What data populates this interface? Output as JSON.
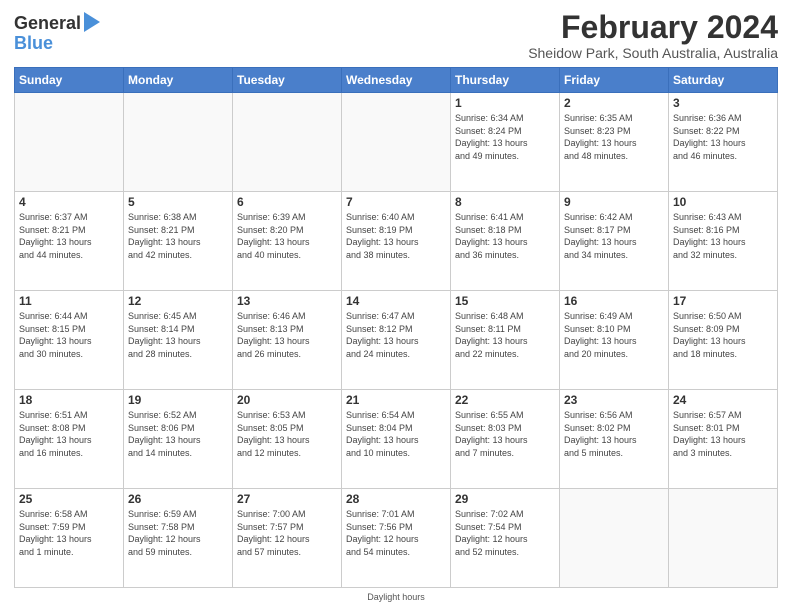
{
  "header": {
    "logo": {
      "general": "General",
      "blue": "Blue"
    },
    "title": "February 2024",
    "subtitle": "Sheidow Park, South Australia, Australia"
  },
  "days_of_week": [
    "Sunday",
    "Monday",
    "Tuesday",
    "Wednesday",
    "Thursday",
    "Friday",
    "Saturday"
  ],
  "weeks": [
    [
      {
        "day": "",
        "info": ""
      },
      {
        "day": "",
        "info": ""
      },
      {
        "day": "",
        "info": ""
      },
      {
        "day": "",
        "info": ""
      },
      {
        "day": "1",
        "info": "Sunrise: 6:34 AM\nSunset: 8:24 PM\nDaylight: 13 hours\nand 49 minutes."
      },
      {
        "day": "2",
        "info": "Sunrise: 6:35 AM\nSunset: 8:23 PM\nDaylight: 13 hours\nand 48 minutes."
      },
      {
        "day": "3",
        "info": "Sunrise: 6:36 AM\nSunset: 8:22 PM\nDaylight: 13 hours\nand 46 minutes."
      }
    ],
    [
      {
        "day": "4",
        "info": "Sunrise: 6:37 AM\nSunset: 8:21 PM\nDaylight: 13 hours\nand 44 minutes."
      },
      {
        "day": "5",
        "info": "Sunrise: 6:38 AM\nSunset: 8:21 PM\nDaylight: 13 hours\nand 42 minutes."
      },
      {
        "day": "6",
        "info": "Sunrise: 6:39 AM\nSunset: 8:20 PM\nDaylight: 13 hours\nand 40 minutes."
      },
      {
        "day": "7",
        "info": "Sunrise: 6:40 AM\nSunset: 8:19 PM\nDaylight: 13 hours\nand 38 minutes."
      },
      {
        "day": "8",
        "info": "Sunrise: 6:41 AM\nSunset: 8:18 PM\nDaylight: 13 hours\nand 36 minutes."
      },
      {
        "day": "9",
        "info": "Sunrise: 6:42 AM\nSunset: 8:17 PM\nDaylight: 13 hours\nand 34 minutes."
      },
      {
        "day": "10",
        "info": "Sunrise: 6:43 AM\nSunset: 8:16 PM\nDaylight: 13 hours\nand 32 minutes."
      }
    ],
    [
      {
        "day": "11",
        "info": "Sunrise: 6:44 AM\nSunset: 8:15 PM\nDaylight: 13 hours\nand 30 minutes."
      },
      {
        "day": "12",
        "info": "Sunrise: 6:45 AM\nSunset: 8:14 PM\nDaylight: 13 hours\nand 28 minutes."
      },
      {
        "day": "13",
        "info": "Sunrise: 6:46 AM\nSunset: 8:13 PM\nDaylight: 13 hours\nand 26 minutes."
      },
      {
        "day": "14",
        "info": "Sunrise: 6:47 AM\nSunset: 8:12 PM\nDaylight: 13 hours\nand 24 minutes."
      },
      {
        "day": "15",
        "info": "Sunrise: 6:48 AM\nSunset: 8:11 PM\nDaylight: 13 hours\nand 22 minutes."
      },
      {
        "day": "16",
        "info": "Sunrise: 6:49 AM\nSunset: 8:10 PM\nDaylight: 13 hours\nand 20 minutes."
      },
      {
        "day": "17",
        "info": "Sunrise: 6:50 AM\nSunset: 8:09 PM\nDaylight: 13 hours\nand 18 minutes."
      }
    ],
    [
      {
        "day": "18",
        "info": "Sunrise: 6:51 AM\nSunset: 8:08 PM\nDaylight: 13 hours\nand 16 minutes."
      },
      {
        "day": "19",
        "info": "Sunrise: 6:52 AM\nSunset: 8:06 PM\nDaylight: 13 hours\nand 14 minutes."
      },
      {
        "day": "20",
        "info": "Sunrise: 6:53 AM\nSunset: 8:05 PM\nDaylight: 13 hours\nand 12 minutes."
      },
      {
        "day": "21",
        "info": "Sunrise: 6:54 AM\nSunset: 8:04 PM\nDaylight: 13 hours\nand 10 minutes."
      },
      {
        "day": "22",
        "info": "Sunrise: 6:55 AM\nSunset: 8:03 PM\nDaylight: 13 hours\nand 7 minutes."
      },
      {
        "day": "23",
        "info": "Sunrise: 6:56 AM\nSunset: 8:02 PM\nDaylight: 13 hours\nand 5 minutes."
      },
      {
        "day": "24",
        "info": "Sunrise: 6:57 AM\nSunset: 8:01 PM\nDaylight: 13 hours\nand 3 minutes."
      }
    ],
    [
      {
        "day": "25",
        "info": "Sunrise: 6:58 AM\nSunset: 7:59 PM\nDaylight: 13 hours\nand 1 minute."
      },
      {
        "day": "26",
        "info": "Sunrise: 6:59 AM\nSunset: 7:58 PM\nDaylight: 12 hours\nand 59 minutes."
      },
      {
        "day": "27",
        "info": "Sunrise: 7:00 AM\nSunset: 7:57 PM\nDaylight: 12 hours\nand 57 minutes."
      },
      {
        "day": "28",
        "info": "Sunrise: 7:01 AM\nSunset: 7:56 PM\nDaylight: 12 hours\nand 54 minutes."
      },
      {
        "day": "29",
        "info": "Sunrise: 7:02 AM\nSunset: 7:54 PM\nDaylight: 12 hours\nand 52 minutes."
      },
      {
        "day": "",
        "info": ""
      },
      {
        "day": "",
        "info": ""
      }
    ]
  ],
  "footer": {
    "daylight_label": "Daylight hours"
  }
}
